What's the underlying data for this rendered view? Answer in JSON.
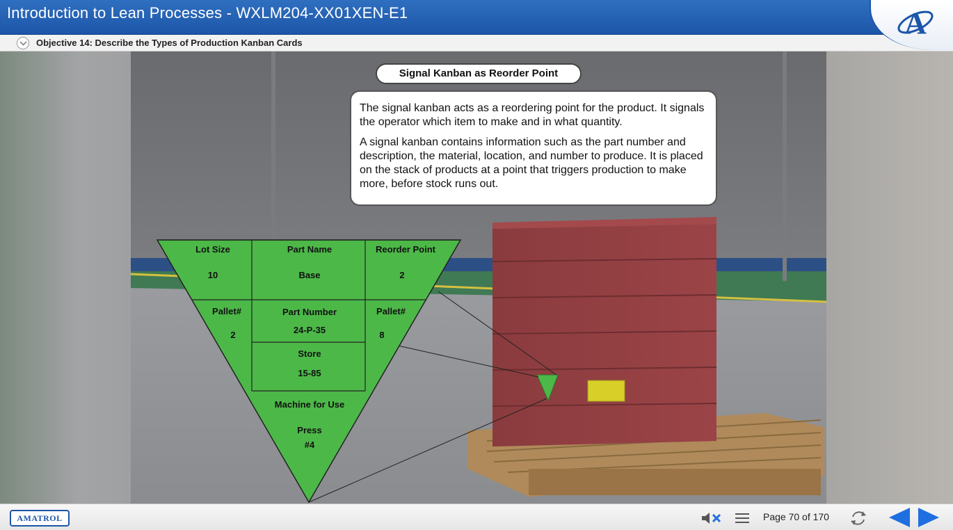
{
  "header": {
    "course_title": "Introduction to Lean Processes - WXLM204-XX01XEN-E1",
    "objective": "Objective 14: Describe the Types of Production Kanban Cards"
  },
  "slide": {
    "title": "Signal Kanban as Reorder Point",
    "paragraphs": [
      "The signal kanban acts as a reordering point for the product. It signals the operator which item to make and in what quantity.",
      "A signal kanban contains information such as the part number and description, the material, location, and number to produce. It is placed on the stack of products at a point that triggers production to make more, before stock runs out."
    ]
  },
  "kanban": {
    "lot_size_label": "Lot Size",
    "lot_size_value": "10",
    "part_name_label": "Part Name",
    "part_name_value": "Base",
    "reorder_label": "Reorder Point",
    "reorder_value": "2",
    "pallet_left_label": "Pallet#",
    "pallet_left_value": "2",
    "part_number_label": "Part Number",
    "part_number_value": "24-P-35",
    "pallet_right_label": "Pallet#",
    "pallet_right_value": "8",
    "store_label": "Store",
    "store_value": "15-85",
    "machine_label": "Machine for Use",
    "machine_value_1": "Press",
    "machine_value_2": "#4"
  },
  "footer": {
    "brand": "AMATROL",
    "page_indicator": "Page 70 of 170"
  },
  "icons": [
    "chevron-down-icon",
    "amatrol-a-logo",
    "mute-icon",
    "menu-icon",
    "replay-icon",
    "prev-arrow-icon",
    "next-arrow-icon"
  ],
  "colors": {
    "header_blue": "#1d56a8",
    "kanban_green": "#4cb848",
    "nav_blue": "#1f6fe0"
  }
}
